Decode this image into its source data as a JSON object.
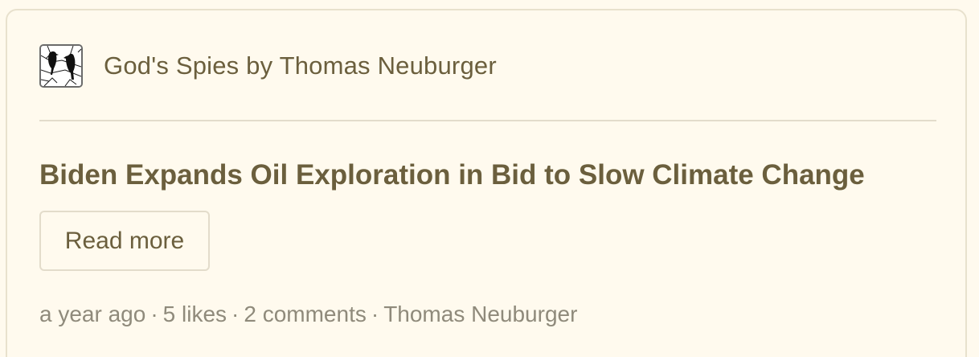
{
  "publication": {
    "name": "God's Spies by Thomas Neuburger",
    "logo_icon": "two-crows-on-branches-icon"
  },
  "post": {
    "title": "Biden Expands Oil Exploration in Bid to Slow Climate Change",
    "read_more_label": "Read more"
  },
  "meta": {
    "time": "a year ago",
    "likes": "5 likes",
    "comments": "2 comments",
    "author": "Thomas Neuburger",
    "separator": "·"
  },
  "colors": {
    "background": "#fffaee",
    "border": "#e3dccb",
    "text_primary": "#6b5f3d",
    "text_muted": "#8f8a7b"
  }
}
